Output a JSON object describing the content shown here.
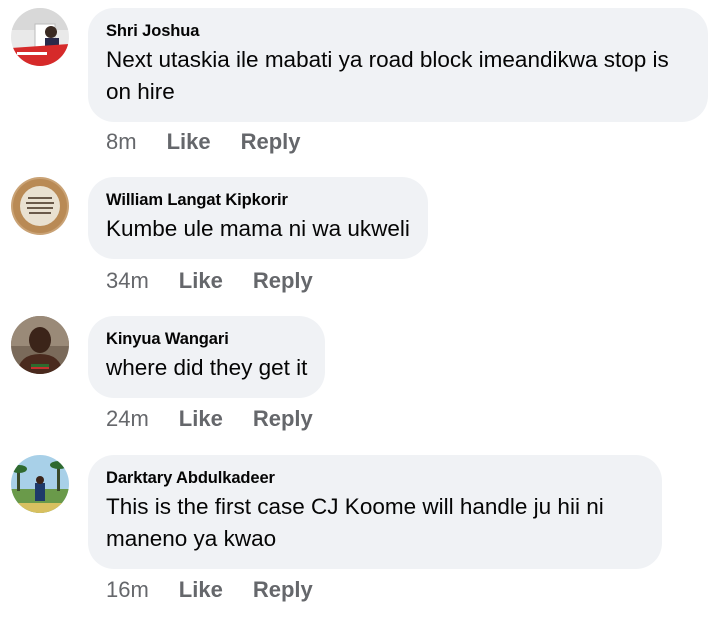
{
  "comments": [
    {
      "author": "Shri Joshua",
      "text": "Next utaskia ile mabati ya road block imeandikwa stop is on hire",
      "time": "8m",
      "like_label": "Like",
      "reply_label": "Reply"
    },
    {
      "author": "William Langat Kipkorir",
      "text": "Kumbe ule mama ni wa ukweli",
      "time": "34m",
      "like_label": "Like",
      "reply_label": "Reply"
    },
    {
      "author": "Kinyua Wangari",
      "text": "where did they get it",
      "time": "24m",
      "like_label": "Like",
      "reply_label": "Reply"
    },
    {
      "author": "Darktary Abdulkadeer",
      "text": "This is the first case CJ Koome will handle ju hii ni maneno ya kwao",
      "time": "16m",
      "like_label": "Like",
      "reply_label": "Reply"
    }
  ],
  "colors": {
    "bubble": "#f0f2f5",
    "text": "#050505",
    "secondary": "#65676b"
  }
}
